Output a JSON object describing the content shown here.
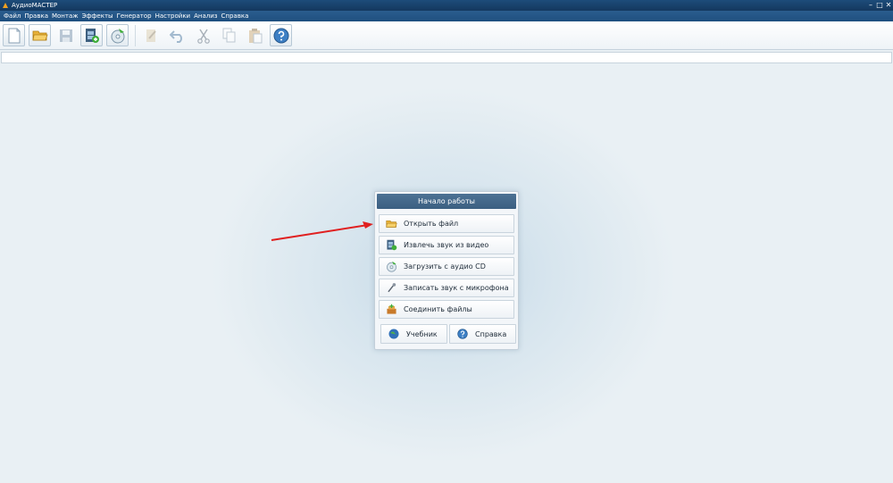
{
  "window": {
    "title": "АудиоМАСТЕР",
    "minimize": "–",
    "maximize": "□",
    "close": "✕"
  },
  "menu": [
    "Файл",
    "Правка",
    "Монтаж",
    "Эффекты",
    "Генератор",
    "Настройки",
    "Анализ",
    "Справка"
  ],
  "toolbar": {
    "buttons": [
      {
        "icon": "new-file-icon",
        "enabled": true
      },
      {
        "icon": "open-folder-icon",
        "enabled": true
      },
      {
        "icon": "save-icon",
        "enabled": false
      },
      {
        "icon": "video-extract-icon",
        "enabled": true
      },
      {
        "icon": "cd-load-icon",
        "enabled": true
      },
      {
        "icon": "microphone-icon",
        "enabled": false
      },
      {
        "icon": "undo-icon",
        "enabled": false
      },
      {
        "icon": "cut-icon",
        "enabled": false
      },
      {
        "icon": "copy-icon",
        "enabled": false
      },
      {
        "icon": "paste-icon",
        "enabled": false
      },
      {
        "icon": "help-icon",
        "enabled": true
      }
    ]
  },
  "start_panel": {
    "title": "Начало работы",
    "actions": [
      {
        "label": "Открыть файл",
        "icon": "open-folder-icon"
      },
      {
        "label": "Извлечь звук из видео",
        "icon": "video-extract-icon"
      },
      {
        "label": "Загрузить с аудио CD",
        "icon": "cd-load-icon"
      },
      {
        "label": "Записать звук с микрофона",
        "icon": "microphone-icon"
      },
      {
        "label": "Соединить файлы",
        "icon": "join-files-icon"
      }
    ],
    "tutorial_label": "Учебник",
    "help_label": "Справка"
  },
  "colors": {
    "accent": "#3b5f81",
    "annotation_arrow": "#e02020"
  }
}
